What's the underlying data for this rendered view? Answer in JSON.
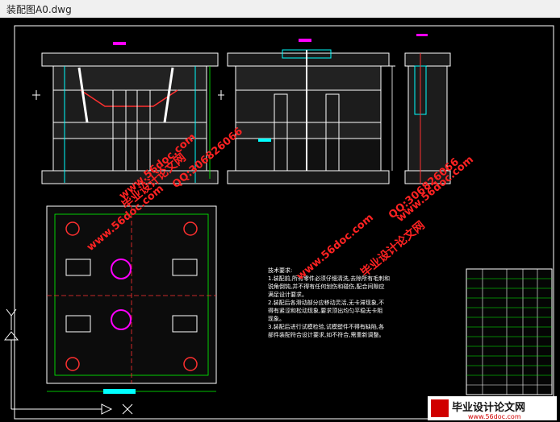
{
  "window": {
    "title": "装配图A0.dwg"
  },
  "notes": {
    "heading": "技术要求:",
    "lines": [
      "1.装配前,所有零件必须仔细清洗,去除所有毛刺和",
      "锐角倒钝,并不得有任何划伤和碰伤,配合间隙应",
      "满足设计要求。",
      "2.装配后各滑动部分应移动灵活,无卡滞现象,不",
      "得有紧涩和松动现象,要求顶出均匀平稳无卡阻",
      "现象。",
      "3.装配后进行试模检验,试模塑件不得有缺陷,各",
      "部件装配符合设计要求,如不符合,需重新调整。"
    ]
  },
  "watermarks": {
    "site": "www.56doc.com",
    "qq": "QQ:306826066",
    "brand": "毕业设计论文网"
  },
  "footer_logo": {
    "text": "毕业设计论文网",
    "url": "www.56doc.com"
  },
  "colors": {
    "background": "#000000",
    "line_white": "#ffffff",
    "line_cyan": "#00ffff",
    "line_green": "#00ff00",
    "line_yellow": "#ffff00",
    "line_magenta": "#ff00ff",
    "line_red": "#ff3030",
    "watermark_red": "#ff2222"
  }
}
